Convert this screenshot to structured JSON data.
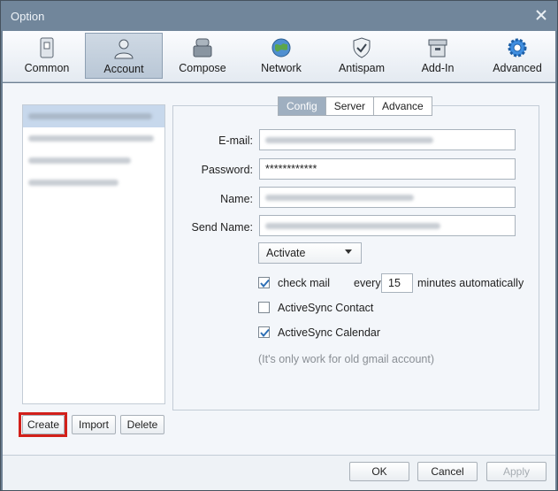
{
  "window": {
    "title": "Option"
  },
  "toolbar": {
    "items": [
      {
        "label": "Common",
        "icon": "device-icon"
      },
      {
        "label": "Account",
        "icon": "user-icon",
        "active": true
      },
      {
        "label": "Compose",
        "icon": "compose-icon"
      },
      {
        "label": "Network",
        "icon": "globe-icon"
      },
      {
        "label": "Antispam",
        "icon": "shield-icon"
      },
      {
        "label": "Add-In",
        "icon": "box-icon"
      },
      {
        "label": "Advanced",
        "icon": "gear-icon"
      }
    ]
  },
  "accounts": {
    "selected_index": 0,
    "count": 4
  },
  "account_buttons": {
    "create": "Create",
    "import": "Import",
    "delete": "Delete"
  },
  "tabs": {
    "config": "Config",
    "server": "Server",
    "advance": "Advance",
    "active": "Config"
  },
  "form": {
    "email_label": "E-mail:",
    "password_label": "Password:",
    "password_value": "************",
    "name_label": "Name:",
    "send_name_label": "Send Name:",
    "mode_select": "Activate",
    "check_mail_label": "check mail",
    "check_mail_checked": true,
    "every_label": "every",
    "interval_value": "15",
    "interval_suffix": "minutes automatically",
    "activesync_contact_label": "ActiveSync Contact",
    "activesync_contact_checked": false,
    "activesync_calendar_label": "ActiveSync Calendar",
    "activesync_calendar_checked": true,
    "note": "(It's only work for old gmail account)"
  },
  "footer": {
    "ok": "OK",
    "cancel": "Cancel",
    "apply": "Apply"
  },
  "colors": {
    "highlight": "#d2201a",
    "active_tab": "#9fafc0"
  }
}
